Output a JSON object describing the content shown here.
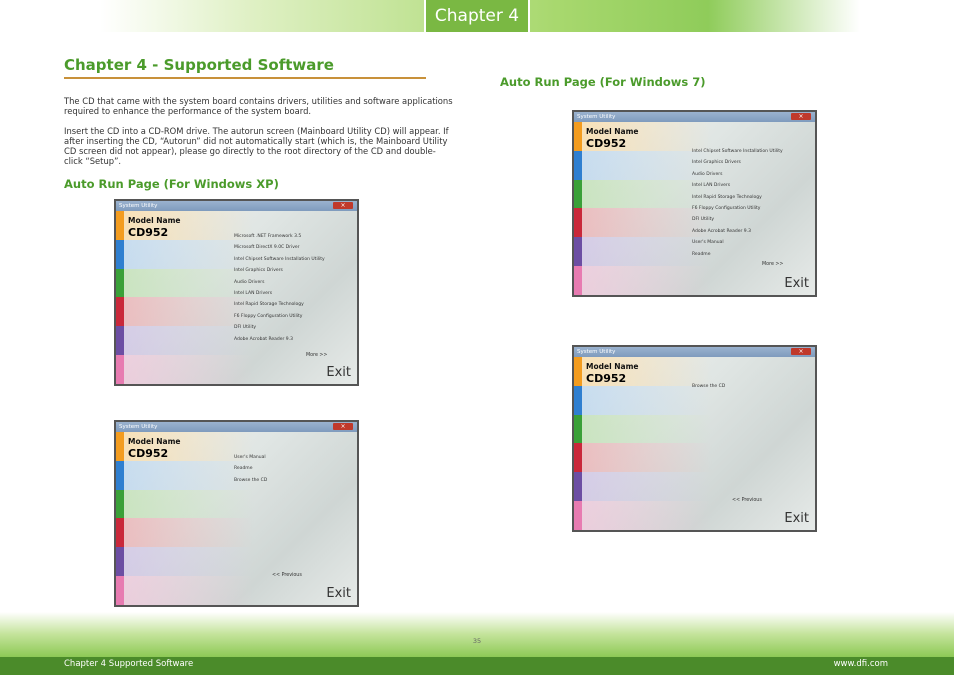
{
  "header": {
    "chapter_tab": "Chapter 4"
  },
  "section": {
    "title": "Chapter 4 - Supported Software",
    "para1": "The CD that came with the system board contains drivers, utilities and software applications required to enhance the performance of the system board.",
    "para2": "Insert the CD into a CD-ROM drive. The autorun screen (Mainboard Utility CD) will appear. If after inserting the CD, “Autorun” did not automatically start (which is, the Mainboard Utility CD screen did not appear), please go directly to the root directory of the CD and double-click “Setup”.",
    "xp_heading": "Auto Run Page (For Windows XP)",
    "w7_heading": "Auto Run Page (For Windows 7)"
  },
  "windows": {
    "xp1": {
      "title": "System Utility",
      "model_label": "Model Name",
      "model_name": "CD952",
      "items": [
        "Microsoft .NET Framework 3.5",
        "Microsoft DirectX 9.0C Driver",
        "Intel Chipset Software Installation Utility",
        "Intel Graphics Drivers",
        "Audio Drivers",
        "Intel LAN Drivers",
        "Intel Rapid Storage Technology",
        "F6 Floppy Configuration Utility",
        "DFI Utility",
        "Adobe Acrobat Reader 9.3"
      ],
      "nav": "More >>",
      "exit": "Exit"
    },
    "xp2": {
      "title": "System Utility",
      "model_label": "Model Name",
      "model_name": "CD952",
      "items": [
        "User's Manual",
        "Readme",
        "Browse the CD"
      ],
      "nav": "<< Previous",
      "exit": "Exit"
    },
    "w71": {
      "title": "System Utility",
      "model_label": "Model Name",
      "model_name": "CD952",
      "items": [
        "Intel Chipset Software Installation Utility",
        "Intel Graphics Drivers",
        "Audio Drivers",
        "Intel LAN Drivers",
        "Intel Rapid Storage Technology",
        "F6 Floppy Configuration Utility",
        "DFI Utility",
        "Adobe Acrobat Reader 9.3",
        "User's Manual",
        "Readme"
      ],
      "nav": "More >>",
      "exit": "Exit"
    },
    "w72": {
      "title": "System Utility",
      "model_label": "Model Name",
      "model_name": "CD952",
      "items": [
        "Browse the CD"
      ],
      "nav": "<< Previous",
      "exit": "Exit"
    }
  },
  "footer": {
    "page_number": "35",
    "left": "Chapter 4 Supported Software",
    "right": "www.dfi.com"
  }
}
